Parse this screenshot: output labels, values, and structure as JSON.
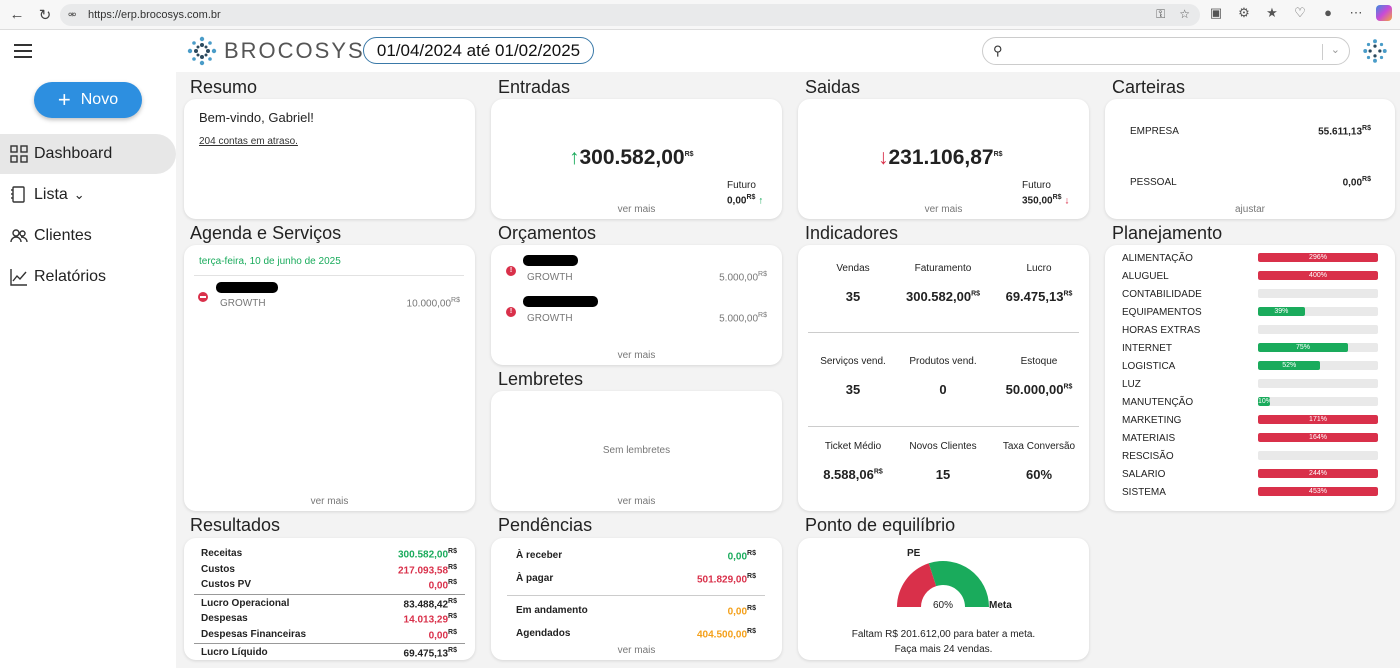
{
  "browser": {
    "url": "https://erp.brocosys.com.br"
  },
  "header": {
    "logo_text": "BROCOSYS",
    "date_range": "01/04/2024 até 01/02/2025"
  },
  "sidebar": {
    "novo_label": "Novo",
    "items": [
      {
        "label": "Dashboard"
      },
      {
        "label": "Lista"
      },
      {
        "label": "Clientes"
      },
      {
        "label": "Relatórios"
      }
    ]
  },
  "colors": {
    "accent": "#2d8fe0",
    "positive": "#1aab5c",
    "negative": "#d9304a",
    "warning": "#f4a01a"
  },
  "resumo": {
    "title": "Resumo",
    "welcome": "Bem-vindo, Gabriel!",
    "overdue": "204 contas em atraso."
  },
  "entradas": {
    "title": "Entradas",
    "value": "300.582,00",
    "currency": "R$",
    "futuro_label": "Futuro",
    "futuro_value": "0,00",
    "ver_mais": "ver mais"
  },
  "saidas": {
    "title": "Saidas",
    "value": "231.106,87",
    "currency": "R$",
    "futuro_label": "Futuro",
    "futuro_value": "350,00",
    "ver_mais": "ver mais"
  },
  "carteiras": {
    "title": "Carteiras",
    "items": [
      {
        "name": "EMPRESA",
        "value": "55.611,13"
      },
      {
        "name": "PESSOAL",
        "value": "0,00"
      }
    ],
    "currency": "R$",
    "ajustar": "ajustar"
  },
  "agenda": {
    "title": "Agenda e Serviços",
    "date": "terça-feira, 10 de junho de 2025",
    "items": [
      {
        "category": "GROWTH",
        "value": "10.000,00"
      }
    ],
    "currency": "R$",
    "ver_mais": "ver mais"
  },
  "orcamentos": {
    "title": "Orçamentos",
    "items": [
      {
        "category": "GROWTH",
        "value": "5.000,00"
      },
      {
        "category": "GROWTH",
        "value": "5.000,00"
      }
    ],
    "currency": "R$",
    "ver_mais": "ver mais"
  },
  "lembretes": {
    "title": "Lembretes",
    "empty": "Sem lembretes",
    "ver_mais": "ver mais"
  },
  "indicadores": {
    "title": "Indicadores",
    "rows": [
      [
        {
          "label": "Vendas",
          "value": "35",
          "currency": ""
        },
        {
          "label": "Faturamento",
          "value": "300.582,00",
          "currency": "R$"
        },
        {
          "label": "Lucro",
          "value": "69.475,13",
          "currency": "R$"
        }
      ],
      [
        {
          "label": "Serviços vend.",
          "value": "35",
          "currency": ""
        },
        {
          "label": "Produtos vend.",
          "value": "0",
          "currency": ""
        },
        {
          "label": "Estoque",
          "value": "50.000,00",
          "currency": "R$"
        }
      ],
      [
        {
          "label": "Ticket Médio",
          "value": "8.588,06",
          "currency": "R$"
        },
        {
          "label": "Novos Clientes",
          "value": "15",
          "currency": ""
        },
        {
          "label": "Taxa Conversão",
          "value": "60%",
          "currency": ""
        }
      ]
    ]
  },
  "planejamento": {
    "title": "Planejamento",
    "items": [
      {
        "name": "ALIMENTAÇÃO",
        "percent": 296,
        "label": "296%",
        "status": "over"
      },
      {
        "name": "ALUGUEL",
        "percent": 400,
        "label": "400%",
        "status": "over"
      },
      {
        "name": "CONTABILIDADE",
        "percent": 0,
        "label": "",
        "status": "empty"
      },
      {
        "name": "EQUIPAMENTOS",
        "percent": 39,
        "label": "39%",
        "status": "ok"
      },
      {
        "name": "HORAS EXTRAS",
        "percent": 0,
        "label": "",
        "status": "empty"
      },
      {
        "name": "INTERNET",
        "percent": 75,
        "label": "75%",
        "status": "ok"
      },
      {
        "name": "LOGISTICA",
        "percent": 52,
        "label": "52%",
        "status": "ok"
      },
      {
        "name": "LUZ",
        "percent": 0,
        "label": "",
        "status": "empty"
      },
      {
        "name": "MANUTENÇÃO",
        "percent": 10,
        "label": "10%",
        "status": "ok"
      },
      {
        "name": "MARKETING",
        "percent": 171,
        "label": "171%",
        "status": "over"
      },
      {
        "name": "MATERIAIS",
        "percent": 164,
        "label": "164%",
        "status": "over"
      },
      {
        "name": "RESCISÃO",
        "percent": 0,
        "label": "",
        "status": "empty"
      },
      {
        "name": "SALARIO",
        "percent": 244,
        "label": "244%",
        "status": "over"
      },
      {
        "name": "SISTEMA",
        "percent": 453,
        "label": "453%",
        "status": "over"
      }
    ]
  },
  "resultados": {
    "title": "Resultados",
    "rows": [
      {
        "label": "Receitas",
        "value": "300.582,00",
        "color": "green"
      },
      {
        "label": "Custos",
        "value": "217.093,58",
        "color": "red"
      },
      {
        "label": "Custos PV",
        "value": "0,00",
        "color": "red"
      },
      {
        "label": "Lucro Operacional",
        "value": "83.488,42",
        "color": "dark"
      },
      {
        "label": "Despesas",
        "value": "14.013,29",
        "color": "red"
      },
      {
        "label": "Despesas Financeiras",
        "value": "0,00",
        "color": "red"
      },
      {
        "label": "Lucro Líquido",
        "value": "69.475,13",
        "color": "dark"
      }
    ],
    "currency": "R$"
  },
  "pendencias": {
    "title": "Pendências",
    "rows": [
      {
        "label": "À receber",
        "value": "0,00",
        "color": "green"
      },
      {
        "label": "À pagar",
        "value": "501.829,00",
        "color": "red"
      },
      {
        "label": "Em andamento",
        "value": "0,00",
        "color": "orange"
      },
      {
        "label": "Agendados",
        "value": "404.500,00",
        "color": "orange"
      }
    ],
    "currency": "R$",
    "ver_mais": "ver mais"
  },
  "equilibrio": {
    "title": "Ponto de equilíbrio",
    "pe_label": "PE",
    "meta_label": "Meta",
    "percent_label": "60%",
    "pe_fraction": 0.4,
    "message1": "Faltam R$ 201.612,00 para bater a meta.",
    "message2": "Faça mais 24 vendas."
  }
}
